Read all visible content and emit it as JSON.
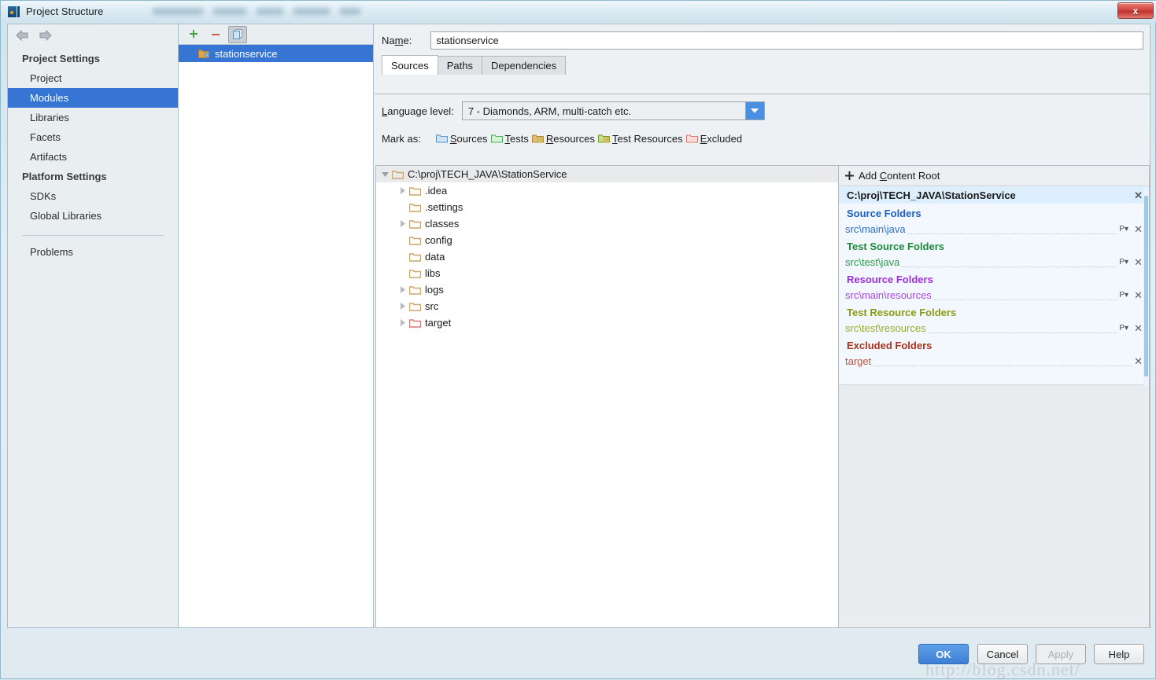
{
  "window": {
    "title": "Project Structure",
    "title_redacted": true,
    "close_label": "x"
  },
  "sidebar": {
    "back_icon": "arrow-left-icon",
    "forward_icon": "arrow-right-icon",
    "groups": [
      {
        "label": "Project Settings",
        "items": [
          {
            "label": "Project",
            "selected": false
          },
          {
            "label": "Modules",
            "selected": true
          },
          {
            "label": "Libraries",
            "selected": false
          },
          {
            "label": "Facets",
            "selected": false
          },
          {
            "label": "Artifacts",
            "selected": false
          }
        ]
      },
      {
        "label": "Platform Settings",
        "items": [
          {
            "label": "SDKs",
            "selected": false
          },
          {
            "label": "Global Libraries",
            "selected": false
          }
        ]
      }
    ],
    "problems": {
      "label": "Problems"
    }
  },
  "module_list": {
    "toolbar": {
      "add_label": "+",
      "remove_label": "−",
      "copy_label": "copy-icon"
    },
    "modules": [
      {
        "label": "stationservice",
        "selected": true
      }
    ]
  },
  "main": {
    "name_label": "Name:",
    "name_value": "stationservice",
    "tabs": [
      {
        "label": "Sources",
        "active": true
      },
      {
        "label": "Paths",
        "active": false
      },
      {
        "label": "Dependencies",
        "active": false
      }
    ],
    "language_level_label": "Language level:",
    "language_level_value": "7 - Diamonds, ARM, multi-catch etc.",
    "mark_as_label": "Mark as:",
    "mark_as_buttons": [
      {
        "label": "Sources",
        "mnemonic": "S",
        "rest": "ources",
        "color": "#6aa8dc"
      },
      {
        "label": "Tests",
        "mnemonic": "T",
        "rest": "ests",
        "color": "#4daf5a"
      },
      {
        "label": "Resources",
        "mnemonic": "R",
        "rest": "esources",
        "color": "#c79a4a"
      },
      {
        "label": "Test Resources",
        "mnemonic": "T",
        "rest": "est Resources",
        "color": "#8bbf4a"
      },
      {
        "label": "Excluded",
        "mnemonic": "E",
        "rest": "xcluded",
        "color": "#d97b72"
      }
    ]
  },
  "tree": {
    "root": {
      "label": "C:\\proj\\TECH_JAVA\\StationService",
      "expanded": true,
      "color": "#c9a66b"
    },
    "children": [
      {
        "label": ".idea",
        "expandable": true,
        "color": "#c9a66b"
      },
      {
        "label": ".settings",
        "expandable": false,
        "color": "#c9a66b"
      },
      {
        "label": "classes",
        "expandable": true,
        "color": "#c9a66b"
      },
      {
        "label": "config",
        "expandable": false,
        "color": "#c9a66b"
      },
      {
        "label": "data",
        "expandable": false,
        "color": "#c9a66b"
      },
      {
        "label": "libs",
        "expandable": false,
        "color": "#c9a66b"
      },
      {
        "label": "logs",
        "expandable": true,
        "color": "#c9a66b"
      },
      {
        "label": "src",
        "expandable": true,
        "color": "#c9a66b"
      },
      {
        "label": "target",
        "expandable": true,
        "color": "#d97b72"
      }
    ]
  },
  "content_roots": {
    "add_label": "Add Content Root",
    "add_icon": "plus-icon",
    "root_path": "C:\\proj\\TECH_JAVA\\StationService",
    "root_remove_label": "✕",
    "categories": [
      {
        "title": "Source Folders",
        "color": "#1f5fc0",
        "folders": [
          {
            "path": "src\\main\\java",
            "has_package_prefix": true,
            "pkg_label": "P",
            "remove_label": "✕"
          }
        ]
      },
      {
        "title": "Test Source Folders",
        "color": "#1f8a3b",
        "folders": [
          {
            "path": "src\\test\\java",
            "has_package_prefix": true,
            "pkg_label": "P",
            "remove_label": "✕"
          }
        ]
      },
      {
        "title": "Resource Folders",
        "color": "#9b30d9",
        "folders": [
          {
            "path": "src\\main\\resources",
            "has_package_prefix": true,
            "pkg_label": "P",
            "remove_label": "✕"
          }
        ]
      },
      {
        "title": "Test Resource Folders",
        "color": "#8a9b12",
        "folders": [
          {
            "path": "src\\test\\resources",
            "has_package_prefix": true,
            "pkg_label": "P",
            "remove_label": "✕"
          }
        ]
      },
      {
        "title": "Excluded Folders",
        "color": "#a8331f",
        "folders": [
          {
            "path": "target",
            "has_package_prefix": false,
            "pkg_label": "",
            "remove_label": "✕"
          }
        ]
      }
    ]
  },
  "buttons": {
    "ok": "OK",
    "cancel": "Cancel",
    "apply": "Apply",
    "help": "Help"
  },
  "watermark": "http://blog.csdn.net/"
}
